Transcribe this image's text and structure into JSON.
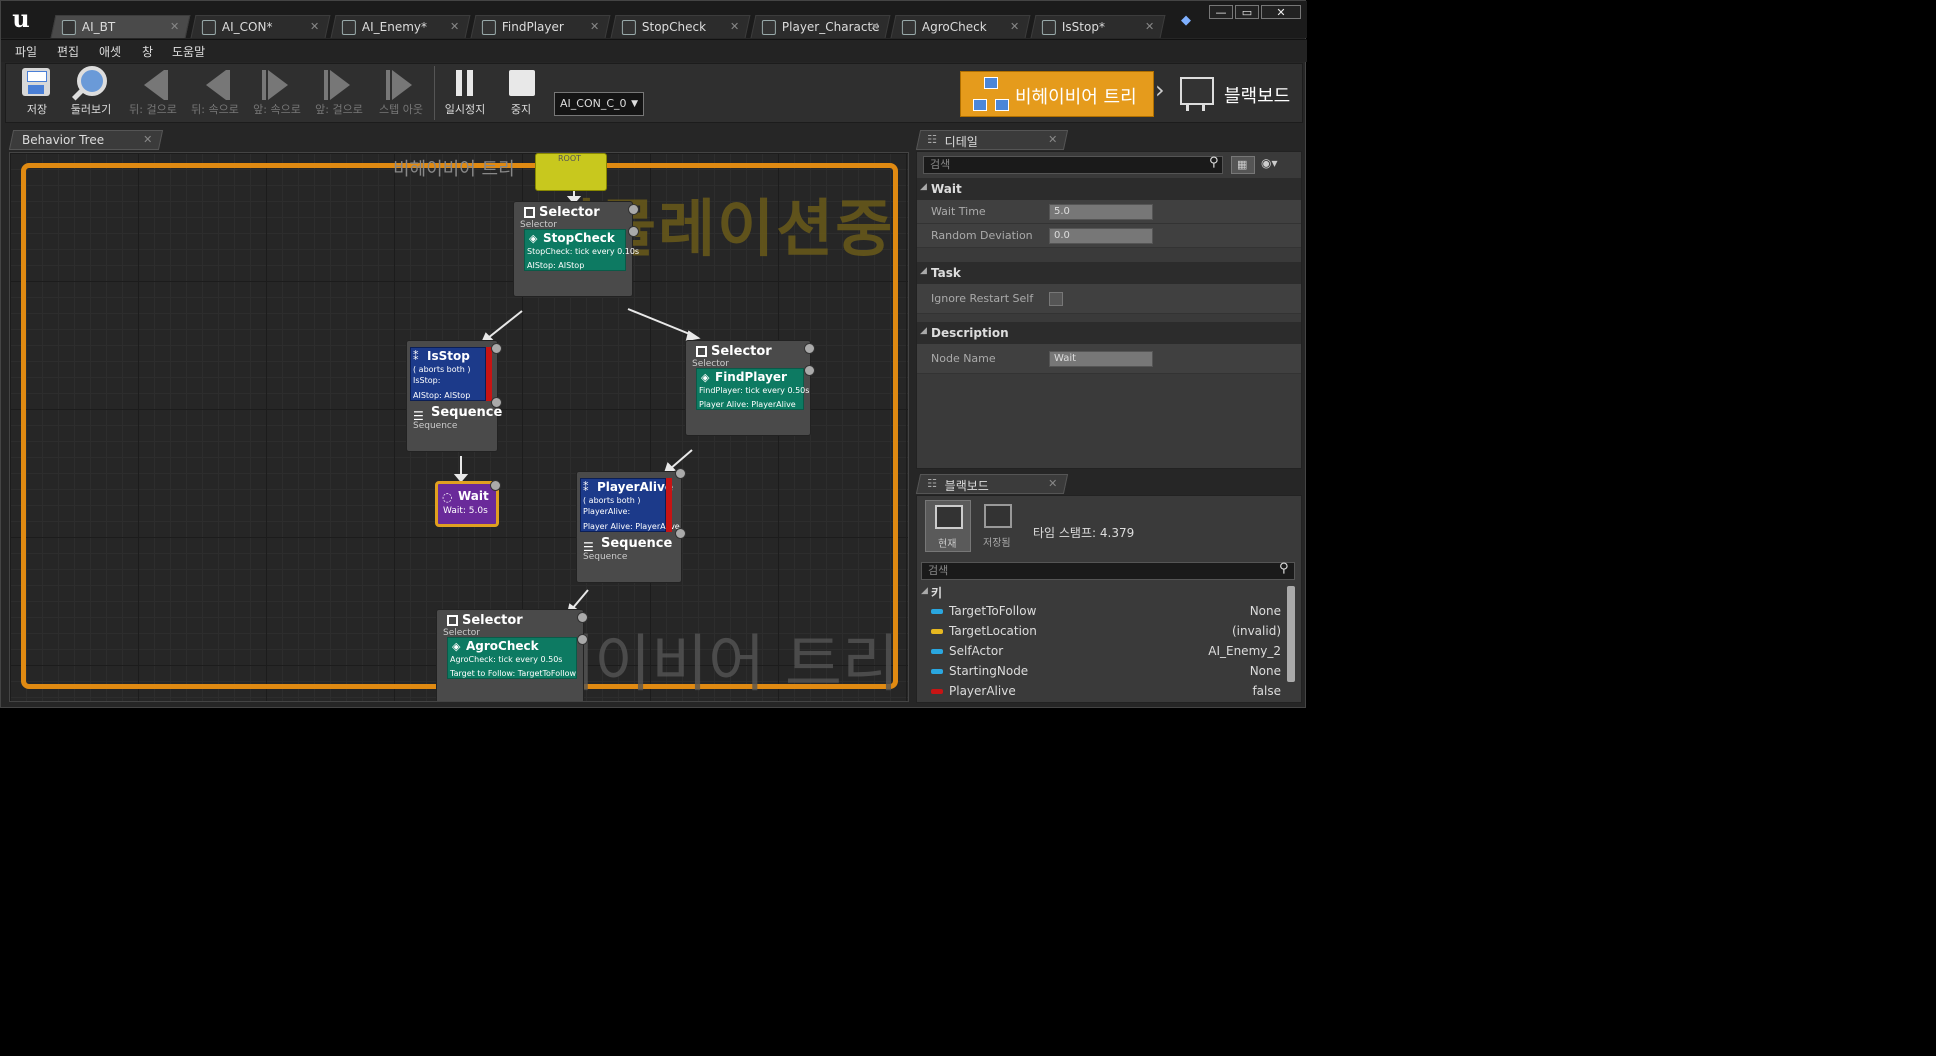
{
  "tabs": [
    {
      "label": "AI_BT",
      "active": true
    },
    {
      "label": "AI_CON*"
    },
    {
      "label": "AI_Enemy*"
    },
    {
      "label": "FindPlayer"
    },
    {
      "label": "StopCheck"
    },
    {
      "label": "Player_Characte"
    },
    {
      "label": "AgroCheck"
    },
    {
      "label": "IsStop*"
    }
  ],
  "window_controls": {
    "minimize": "—",
    "maximize": "▭",
    "close": "✕"
  },
  "menu": [
    "파일",
    "편집",
    "애셋",
    "창",
    "도움말"
  ],
  "toolbar": {
    "save": "저장",
    "browse": "둘러보기",
    "back_over": "뒤: 걸으로",
    "back_into": "뒤: 속으로",
    "forward_into": "앞: 속으로",
    "forward_over": "앞: 걸으로",
    "step_out": "스텝 아웃",
    "pause": "일시정지",
    "stop": "중지",
    "debug_object": "AI_CON_C_0"
  },
  "modes": {
    "behavior_tree": "비헤이비어 트리",
    "blackboard": "블랙보드"
  },
  "graph": {
    "tab_label": "Behavior Tree",
    "watermark_top": "비헤이비어 트리",
    "watermark_sim": "시뮬레이션중",
    "watermark_bottom": "비헤이비어 트리",
    "nodes": {
      "root_label": "ROOT",
      "selector1": {
        "title": "Selector",
        "sub": "Selector",
        "service": "StopCheck",
        "service_sub": "StopCheck: tick every 0.10s",
        "service_key": "AIStop: AIStop"
      },
      "isstop": {
        "title": "IsStop",
        "line1": "( aborts both )",
        "line2": "IsStop:",
        "key": "AIStop: AIStop"
      },
      "sequence1": {
        "title": "Sequence",
        "sub": "Sequence"
      },
      "wait": {
        "title": "Wait",
        "sub": "Wait: 5.0s"
      },
      "selector2": {
        "title": "Selector",
        "sub": "Selector",
        "service": "FindPlayer",
        "service_sub": "FindPlayer: tick every 0.50s",
        "service_key": "Player Alive: PlayerAlive"
      },
      "playeralive": {
        "title": "PlayerAlive",
        "line1": "( aborts both )",
        "line2": "PlayerAlive:",
        "key": "Player Alive: PlayerAlive"
      },
      "sequence2": {
        "title": "Sequence",
        "sub": "Sequence"
      },
      "selector3": {
        "title": "Selector",
        "sub": "Selector",
        "service": "AgroCheck",
        "service_sub": "AgroCheck: tick every 0.50s",
        "service_key": "Target to Follow: TargetToFollow"
      }
    }
  },
  "details": {
    "tab_label": "디테일",
    "search_placeholder": "검색",
    "sections": {
      "wait": "Wait",
      "task": "Task",
      "description": "Description"
    },
    "props": {
      "wait_time_label": "Wait Time",
      "wait_time": "5.0",
      "random_dev_label": "Random Deviation",
      "random_dev": "0.0",
      "ignore_restart_label": "Ignore Restart Self",
      "node_name_label": "Node Name",
      "node_name": "Wait"
    }
  },
  "blackboard": {
    "tab_label": "블랙보드",
    "current": "현재",
    "saved": "저장됨",
    "timestamp": "타임 스탬프: 4.379",
    "search_placeholder": "검색",
    "keys_header": "키",
    "keys": [
      {
        "name": "TargetToFollow",
        "value": "None",
        "color": "#2aa7e0"
      },
      {
        "name": "TargetLocation",
        "value": "(invalid)",
        "color": "#e6b820"
      },
      {
        "name": "SelfActor",
        "value": "AI_Enemy_2",
        "color": "#2aa7e0"
      },
      {
        "name": "StartingNode",
        "value": "None",
        "color": "#2aa7e0"
      },
      {
        "name": "PlayerAlive",
        "value": "false",
        "color": "#c81414"
      }
    ]
  }
}
